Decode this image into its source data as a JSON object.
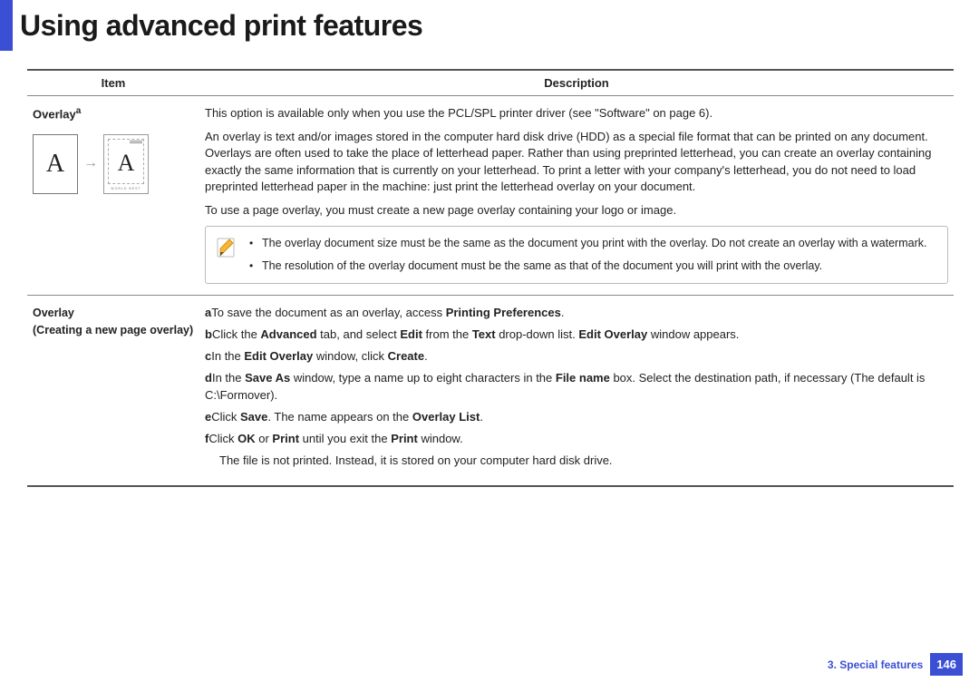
{
  "title": "Using advanced print features",
  "table": {
    "headers": {
      "item": "Item",
      "desc": "Description"
    },
    "row1": {
      "label": "Overlay",
      "sup": "a",
      "p1": "This option is available only when you use the PCL/SPL printer driver (see \"Software\" on page 6).",
      "p2": "An overlay is text and/or images stored in the computer hard disk drive (HDD) as a special file format that can be printed on any document. Overlays are often used to take the place of letterhead paper. Rather than using preprinted letterhead, you can create an overlay containing exactly the same information that is currently on your letterhead. To print a letter with your company's letterhead, you do not need to load preprinted letterhead paper in the machine: just print the letterhead overlay on your document.",
      "p3": "To use a page overlay, you must create a new page overlay containing your logo or image.",
      "note1": "The overlay document size must be the same as the document you print with the overlay. Do not create an overlay with a watermark.",
      "note2": "The resolution of the overlay document must be the same as that of the document you will print with the overlay."
    },
    "row2": {
      "label": "Overlay",
      "sub_open": "(",
      "sub_title": "Creating a new page overlay",
      "sub_close": ")",
      "a_pre": "a",
      "a_t1": "To save the document as an overlay, access ",
      "a_b1": "Printing Preferences",
      "a_t2": ".",
      "b_pre": "b",
      "b_t1": "Click the ",
      "b_b1": "Advanced",
      "b_t2": " tab, and select ",
      "b_b2": "Edit",
      "b_t3": " from the ",
      "b_b3": "Text",
      "b_t4": " drop-down list. ",
      "b_b4": "Edit Overlay",
      "b_t5": " window appears.",
      "c_pre": "c",
      "c_t1": "In the ",
      "c_b1": "Edit Overlay",
      "c_t2": " window, click ",
      "c_b2": "Create",
      "c_t3": ".",
      "d_pre": "d",
      "d_t1": "In the ",
      "d_b1": "Save As",
      "d_t2": " window, type a name up to eight characters in the ",
      "d_b2": "File name",
      "d_t3": " box. Select the destination path, if necessary (The default is C:\\Formover).",
      "e_pre": "e",
      "e_t1": "Click ",
      "e_b1": "Save",
      "e_t2": ". The name appears on the ",
      "e_b2": "Overlay List",
      "e_t3": ".",
      "f_pre": "f",
      "f_t1": "Click ",
      "f_b1": "OK",
      "f_t2": " or ",
      "f_b2": "Print",
      "f_t3": " until you exit the ",
      "f_b3": "Print",
      "f_t4": " window.",
      "tail": "The file is not printed. Instead, it is stored on your computer hard disk drive."
    }
  },
  "diagram": {
    "letter": "A",
    "arrow": "→"
  },
  "footer": {
    "chapter": "3.  Special features",
    "page": "146"
  }
}
